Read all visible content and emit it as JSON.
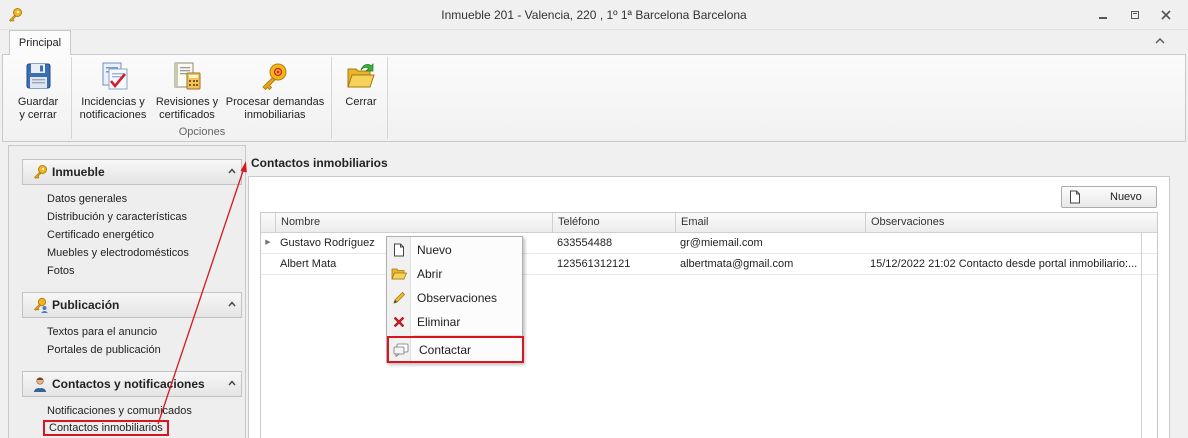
{
  "window": {
    "title": "Inmueble 201 - Valencia, 220 , 1º 1ª Barcelona Barcelona",
    "controls": [
      "minimize",
      "restore",
      "close"
    ]
  },
  "ribbon": {
    "tabs": [
      {
        "label": "Principal",
        "active": true
      }
    ],
    "buttons": {
      "guardar": "Guardar\ny cerrar",
      "incidencias": "Incidencias y\nnotificaciones",
      "revisiones": "Revisiones y\ncertificados",
      "procesar": "Procesar demandas\ninmobiliarias",
      "cerrar": "Cerrar"
    },
    "group_label": "Opciones"
  },
  "sidebar": {
    "groups": [
      {
        "title": "Inmueble",
        "icon": "key-icon",
        "items": [
          "Datos generales",
          "Distribución y características",
          "Certificado energético",
          "Muebles y electrodomésticos",
          "Fotos"
        ]
      },
      {
        "title": "Publicación",
        "icon": "key-people-icon",
        "items": [
          "Textos para el anuncio",
          "Portales de publicación"
        ]
      },
      {
        "title": "Contactos y notificaciones",
        "icon": "person-icon",
        "items": [
          "Notificaciones y comunicados",
          "Contactos inmobiliarios"
        ]
      }
    ],
    "selected_item": "Contactos inmobiliarios"
  },
  "main": {
    "title": "Contactos inmobiliarios",
    "new_button": "Nuevo",
    "grid": {
      "columns": [
        "Nombre",
        "Teléfono",
        "Email",
        "Observaciones"
      ],
      "rows": [
        {
          "nombre": "Gustavo Rodríguez",
          "telefono": "633554488",
          "email": "gr@miemail.com",
          "observaciones": ""
        },
        {
          "nombre": "Albert Mata",
          "telefono": "123561312121",
          "email": "albertmata@gmail.com",
          "observaciones": "15/12/2022 21:02 Contacto desde portal inmobiliario:..."
        }
      ]
    }
  },
  "context_menu": {
    "items": [
      {
        "label": "Nuevo",
        "icon": "new-document-icon"
      },
      {
        "label": "Abrir",
        "icon": "open-folder-icon"
      },
      {
        "label": "Observaciones",
        "icon": "pencil-icon"
      },
      {
        "label": "Eliminar",
        "icon": "red-x-icon"
      },
      {
        "label": "Contactar",
        "icon": "speech-bubbles-icon"
      }
    ],
    "highlighted": "Contactar"
  },
  "colors": {
    "highlight_red": "#d9161f",
    "panel_bg": "#f0f0f0"
  }
}
